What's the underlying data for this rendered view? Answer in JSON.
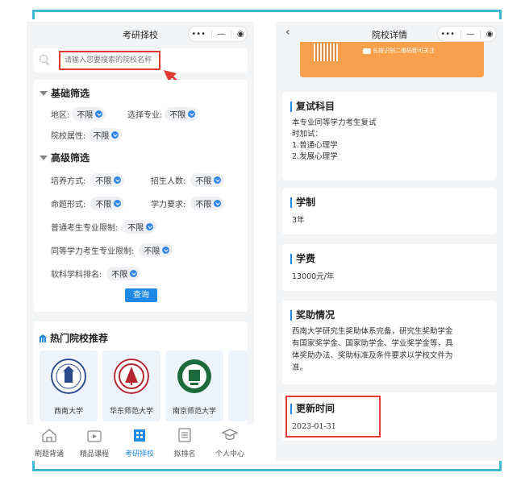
{
  "left_page": {
    "title": "考研择校",
    "capsule_more": "•••",
    "capsule_minimize": "—",
    "capsule_target": "◉",
    "search": {
      "placeholder": "请输入您要搜索的院校名称"
    },
    "basic_filter": {
      "title": "基础筛选",
      "region_label": "地区:",
      "region_value": "不限",
      "major_label": "选择专业:",
      "major_value": "不限",
      "attr_label": "院校属性:",
      "attr_value": "不限"
    },
    "advanced_filter": {
      "title": "高级筛选",
      "mode_label": "培养方式:",
      "mode_value": "不限",
      "enroll_label": "招生人数:",
      "enroll_value": "不限",
      "exam_label": "命题形式:",
      "exam_value": "不限",
      "ability_label": "学力要求:",
      "ability_value": "不限",
      "normal_label": "普通考生专业限制:",
      "normal_value": "不限",
      "equiv_label": "同等学力考生专业限制:",
      "equiv_value": "不限",
      "rank_label": "软科学科排名:",
      "rank_value": "不限"
    },
    "query_button": "查询",
    "hot": {
      "title": "热门院校推荐",
      "schools": [
        "西南大学",
        "华东师范大学",
        "南京师范大学"
      ]
    },
    "tabs": [
      "刷题背诵",
      "精品课程",
      "考研择校",
      "拟排名",
      "个人中心"
    ]
  },
  "right_page": {
    "title": "院校详情",
    "back": "‹",
    "capsule_more": "•••",
    "capsule_minimize": "—",
    "capsule_target": "◉",
    "banner_text": "长按识别二维码即可关注",
    "retest": {
      "title": "复试科目",
      "lines": [
        "本专业同等学力考生复试",
        "时加试：",
        "1.普通心理学",
        "2.发展心理学"
      ]
    },
    "duration": {
      "title": "学制",
      "value": "3年"
    },
    "fee": {
      "title": "学费",
      "value": "13000元/年"
    },
    "award": {
      "title": "奖助情况",
      "lines": [
        "西南大学研究生奖助体系完备，研究生奖助学金",
        "有国家奖学金、国家助学金、学业奖学金等，具",
        "体奖助办法、奖助标准及条件要求以学校文件为",
        "准。"
      ]
    },
    "update": {
      "title": "更新时间",
      "value": "2023-01-31"
    }
  },
  "colors": {
    "accent": "#1e88e5",
    "highlight": "#e53935",
    "frame": "#3fb8d4",
    "banner": "#f8a04b"
  }
}
